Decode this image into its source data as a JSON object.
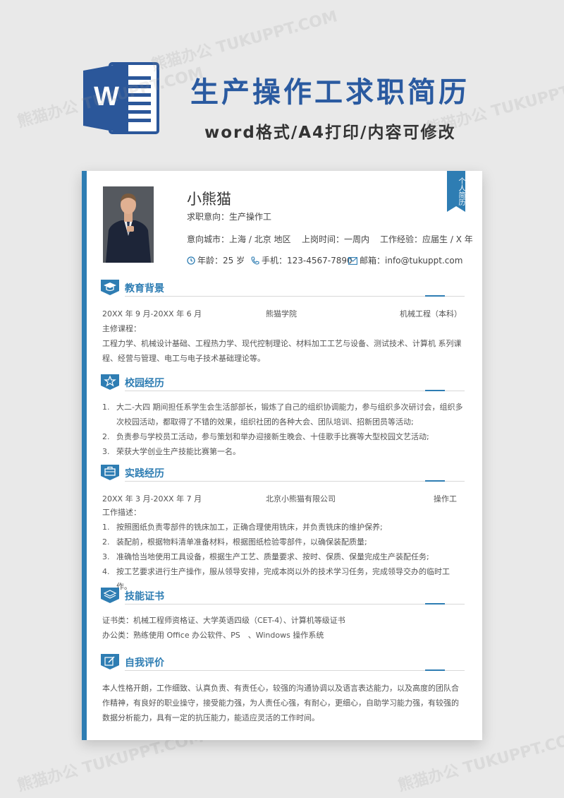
{
  "banner": {
    "title": "生产操作工求职简历",
    "subtitle": "word格式/A4打印/内容可修改",
    "logo_letter": "W",
    "watermark": "熊猫办公 TUKUPPT.COM"
  },
  "colors": {
    "accent": "#2e7db3",
    "banner_title": "#2a5aa0",
    "word_blue": "#2b579a"
  },
  "ribbon_text": "个人简历",
  "profile": {
    "name": "小熊猫",
    "intent_label": "求职意向：",
    "intent": "生产操作工",
    "city_label": "意向城市：",
    "city": "上海 / 北京 地区",
    "start_label": "上岗时间：",
    "start": "一周内",
    "exp_label": "工作经验：",
    "exp": "应届生 / X 年",
    "age_label": "年龄：",
    "age": "25 岁",
    "phone_label": "手机：",
    "phone": "123-4567-7890",
    "email_label": "邮箱：",
    "email": "info@tukuppt.com"
  },
  "education": {
    "title": "教育背景",
    "icon": "graduation-cap-icon",
    "period": "20XX 年 9 月-20XX 年 6 月",
    "school": "熊猫学院",
    "major": "机械工程（本科）",
    "courses_label": "主修课程：",
    "courses": "工程力学、机械设计基础、工程热力学、现代控制理论、材料加工工艺与设备、测试技术、计算机 系列课程、经营与管理、电工与电子技术基础理论等。"
  },
  "campus": {
    "title": "校园经历",
    "icon": "star-icon",
    "items": [
      "大二-大四 期间担任系学生会生活部部长，锻炼了自己的组织协调能力，参与组织多次研讨会，组织多次校园活动，都取得了不错的效果，组织社团的各种大会、团队培训、招新团员等活动;",
      "负责参与学校员工活动，参与策划和举办迎接新生晚会、十佳歌手比赛等大型校园文艺活动;",
      "荣获大学创业生产技能比赛第一名。"
    ]
  },
  "practice": {
    "title": "实践经历",
    "icon": "briefcase-icon",
    "period": "20XX 年 3 月-20XX 年 7 月",
    "company": "北京小熊猫有限公司",
    "position": "操作工",
    "desc_label": "工作描述：",
    "items": [
      "按照图纸负责零部件的铣床加工，正确合理使用铣床，并负责铣床的维护保养;",
      "装配前，根据物料清单准备材料，根据图纸检验零部件，以确保装配质量;",
      "准确恰当地使用工具设备，根据生产工艺、质量要求、按时、保质、保量完成生产装配任务;",
      "按工艺要求进行生产操作，服从领导安排，完成本岗以外的技术学习任务，完成领导交办的临时工作。"
    ]
  },
  "skills": {
    "title": "技能证书",
    "icon": "layers-icon",
    "cert_label": "证书类：",
    "cert": "机械工程师资格证、大学英语四级（CET-4）、计算机等级证书",
    "office_label": "办公类：",
    "office": "熟练使用 Office 办公软件、PS　、Windows 操作系统"
  },
  "self": {
    "title": "自我评价",
    "icon": "edit-icon",
    "text": "本人性格开朗，工作细致、认真负责、有责任心，较强的沟通协调以及语言表达能力，以及高度的团队合作精神，有良好的职业操守，接受能力强，为人责任心强，有耐心，更细心，自助学习能力强，有较强的数据分析能力，具有一定的抗压能力，能适应灵活的工作时间。"
  }
}
